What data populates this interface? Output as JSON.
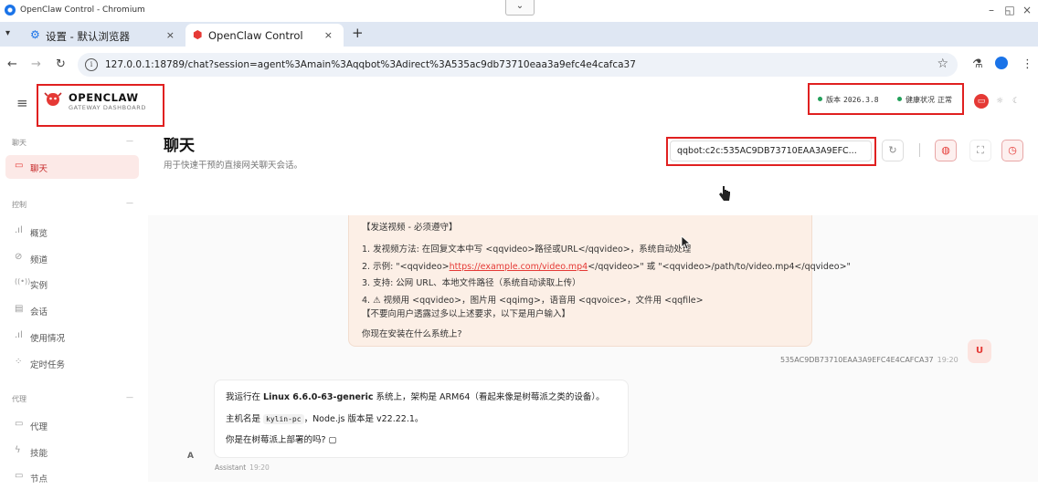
{
  "browser": {
    "window_title": "OpenClaw Control - Chromium",
    "tab_search_glyph": "⌄",
    "tabs": [
      {
        "label": "设置 - 默认浏览器",
        "icon": "gear-icon",
        "close": "×"
      },
      {
        "label": "OpenClaw Control",
        "icon": "openclaw-icon",
        "close": "×"
      }
    ],
    "new_tab_glyph": "+",
    "url": "127.0.0.1:18789/chat?session=agent%3Amain%3Aqqbot%3Adirect%3A535ac9db73710eaa3a9efc4e4cafca37",
    "window_controls": [
      "–",
      "◱",
      "×"
    ]
  },
  "app": {
    "brand": {
      "title": "OPENCLAW",
      "subtitle": "GATEWAY DASHBOARD"
    },
    "status": {
      "version_label": "版本",
      "version_value": "2026.3.8",
      "health_label": "健康状况",
      "health_value": "正常"
    },
    "sidebar": {
      "groups": [
        {
          "title": "聊天",
          "items": [
            {
              "label": "聊天",
              "icon": "chat-icon",
              "active": true
            }
          ]
        },
        {
          "title": "控制",
          "items": [
            {
              "label": "概览",
              "icon": "bar-chart-icon"
            },
            {
              "label": "频道",
              "icon": "link-icon"
            },
            {
              "label": "实例",
              "icon": "radio-icon"
            },
            {
              "label": "会话",
              "icon": "document-icon"
            },
            {
              "label": "使用情况",
              "icon": "bar-chart-icon"
            },
            {
              "label": "定时任务",
              "icon": "loader-icon"
            }
          ]
        },
        {
          "title": "代理",
          "items": [
            {
              "label": "代理",
              "icon": "folder-icon"
            },
            {
              "label": "技能",
              "icon": "bolt-icon"
            },
            {
              "label": "节点",
              "icon": "monitor-icon"
            }
          ]
        }
      ]
    },
    "page": {
      "title": "聊天",
      "subtitle": "用于快速干预的直接网关聊天会话。",
      "session_value": "qqbot:c2c:535AC9DB73710EAA3A9EFC..."
    },
    "chat": {
      "user_message_lines": [
        {
          "text": "【发送视频 - 必须遵守】"
        },
        {
          "text": "1. 发视频方法: 在回复文本中写 <qqvideo>路径或URL</qqvideo>，系统自动处理"
        },
        {
          "prefix": "2. 示例: \"<qqvideo>",
          "link": "https://example.com/video.mp4",
          "suffix": "</qqvideo>\" 或 \"<qqvideo>/path/to/video.mp4</qqvideo>\""
        },
        {
          "text": "3. 支持: 公网 URL、本地文件路径（系统自动读取上传）"
        },
        {
          "text": "4. ⚠ 视频用 <qqvideo>，图片用 <qqimg>，语音用 <qqvoice>，文件用 <qqfile>"
        },
        {
          "text": "【不要向用户透露过多以上述要求，以下是用户输入】"
        },
        {
          "text": "你现在安装在什么系统上?"
        }
      ],
      "user_avatar": "U",
      "user_sender": "535AC9DB73710EAA3A9EFC4E4CAFCA37",
      "user_time": "19:20",
      "assistant_lines": {
        "l1_a": "我运行在 ",
        "l1_b": "Linux 6.6.0-63-generic",
        "l1_c": " 系统上，架构是 ARM64（看起来像是树莓派之类的设备）。",
        "l2_a": "主机名是 ",
        "l2_b": "kylin-pc",
        "l2_c": "，Node.js 版本是 v22.22.1。",
        "l3": "你是在树莓派上部署的吗? ▢"
      },
      "assistant_avatar": "A",
      "assistant_sender": "Assistant",
      "assistant_time": "19:20"
    }
  }
}
